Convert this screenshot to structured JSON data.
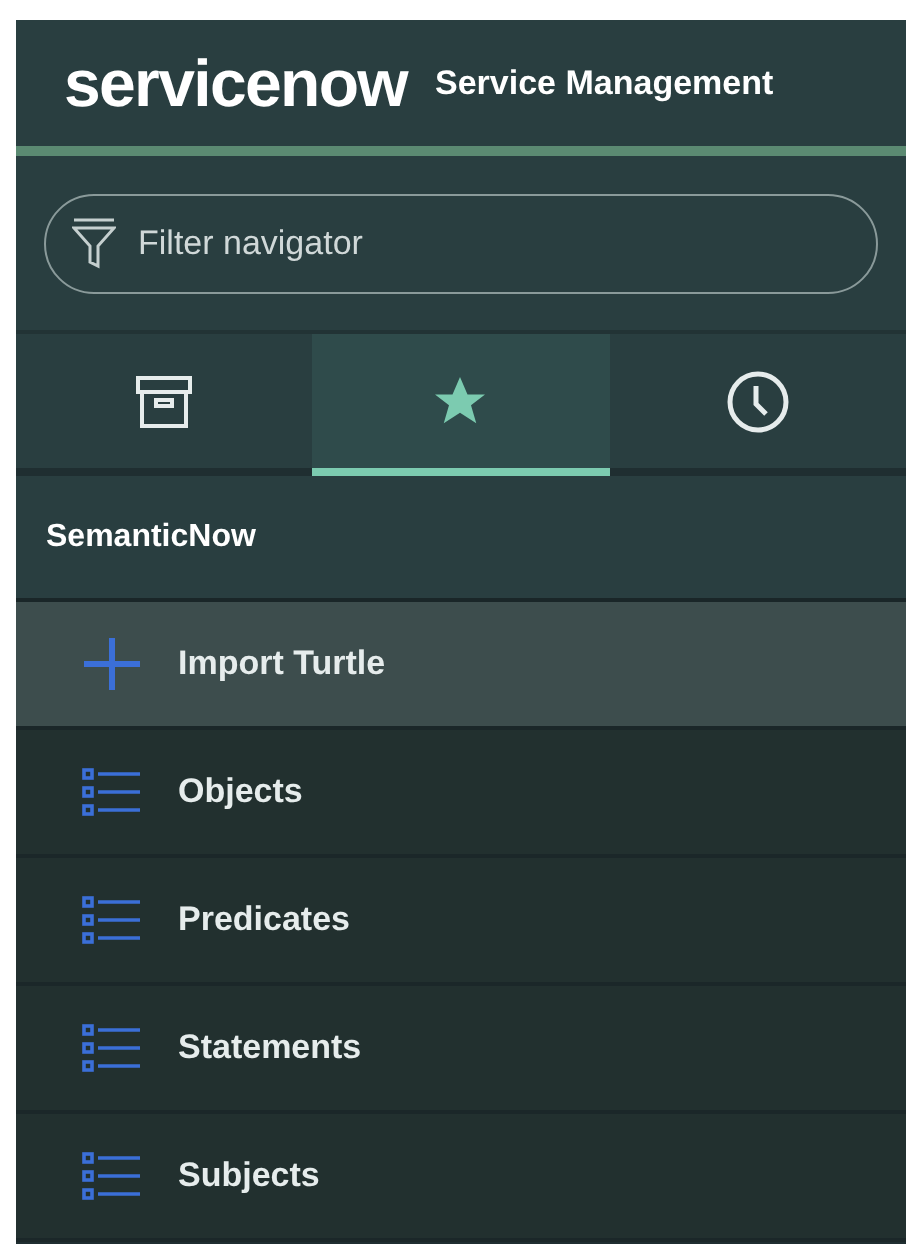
{
  "header": {
    "logo": "servicenow",
    "title": "Service Management"
  },
  "filter": {
    "placeholder": "Filter navigator"
  },
  "tabs": [
    {
      "kind": "archive",
      "selected": false
    },
    {
      "kind": "star",
      "selected": true
    },
    {
      "kind": "clock",
      "selected": false
    }
  ],
  "section": {
    "title": "SemanticNow"
  },
  "items": [
    {
      "label": "Import Turtle",
      "kind": "add",
      "selected": true
    },
    {
      "label": "Objects",
      "kind": "list",
      "selected": false
    },
    {
      "label": "Predicates",
      "kind": "list",
      "selected": false
    },
    {
      "label": "Statements",
      "kind": "list",
      "selected": false
    },
    {
      "label": "Subjects",
      "kind": "list",
      "selected": false
    }
  ]
}
